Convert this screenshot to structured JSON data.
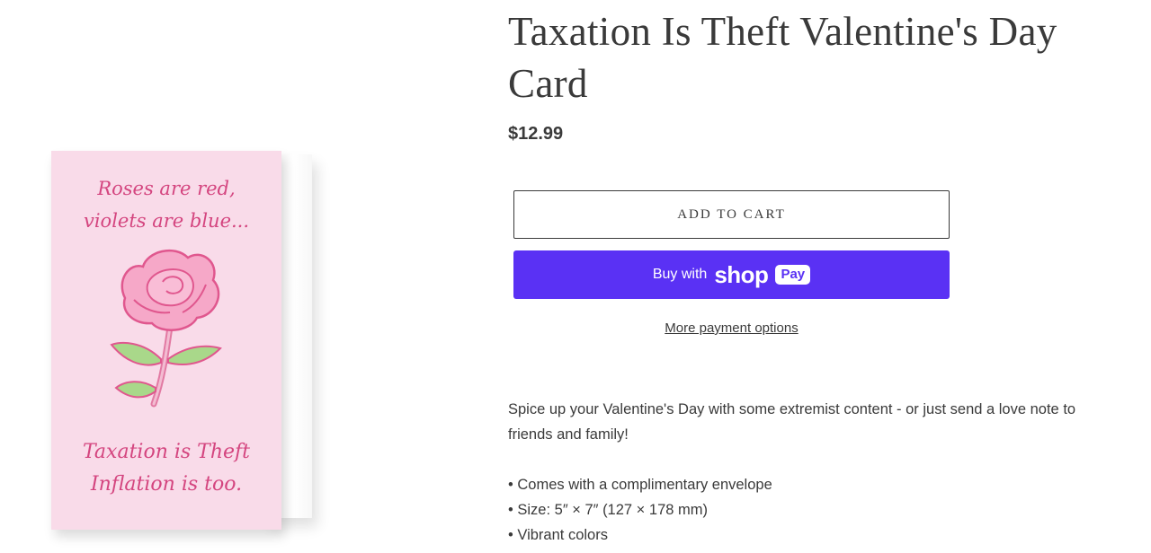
{
  "product": {
    "title": "Taxation Is Theft Valentine's Day Card",
    "price": "$12.99",
    "image": {
      "card_line1": "Roses are red,",
      "card_line2": "violets are blue...",
      "card_line3": "Taxation is Theft",
      "card_line4": "Inflation is too.",
      "card_color": "#f9dbe9",
      "text_color": "#d4457f",
      "illustration": "pink-rose"
    }
  },
  "actions": {
    "add_to_cart": "ADD TO CART",
    "buy_with": "Buy with",
    "shop_word": "shop",
    "pay_badge": "Pay",
    "more_payment_options": "More payment options",
    "shop_pay_color": "#5a31f4"
  },
  "description": {
    "intro": "Spice up your Valentine's Day with some extremist content - or just send a love note to friends and family!",
    "bullets": [
      "Comes with a complimentary envelope",
      "Size: 5″ × 7″ (127 × 178 mm)",
      "Vibrant colors"
    ]
  }
}
